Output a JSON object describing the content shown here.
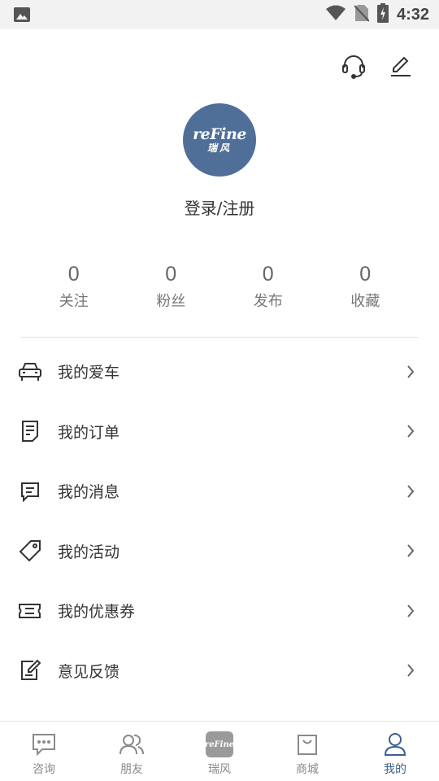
{
  "status_bar": {
    "time": "4:32"
  },
  "profile": {
    "logo_text": "reFine",
    "logo_cn": "瑞风",
    "login_label": "登录/注册"
  },
  "stats": [
    {
      "value": "0",
      "label": "关注"
    },
    {
      "value": "0",
      "label": "粉丝"
    },
    {
      "value": "0",
      "label": "发布"
    },
    {
      "value": "0",
      "label": "收藏"
    }
  ],
  "menu": [
    {
      "label": "我的爱车",
      "icon": "car-icon"
    },
    {
      "label": "我的订单",
      "icon": "order-icon"
    },
    {
      "label": "我的消息",
      "icon": "message-icon"
    },
    {
      "label": "我的活动",
      "icon": "tag-icon"
    },
    {
      "label": "我的优惠券",
      "icon": "coupon-icon"
    },
    {
      "label": "意见反馈",
      "icon": "feedback-icon"
    }
  ],
  "bottom_nav": [
    {
      "label": "咨询",
      "icon": "chat-icon",
      "active": false
    },
    {
      "label": "朋友",
      "icon": "friends-icon",
      "active": false
    },
    {
      "label": "瑞风",
      "icon": "refine-logo-icon",
      "active": false,
      "tile_text": "reFine"
    },
    {
      "label": "商城",
      "icon": "shopping-bag-icon",
      "active": false
    },
    {
      "label": "我的",
      "icon": "user-icon",
      "active": true
    }
  ],
  "colors": {
    "accent": "#3c5f8f",
    "avatar_bg": "#4f6f99"
  }
}
